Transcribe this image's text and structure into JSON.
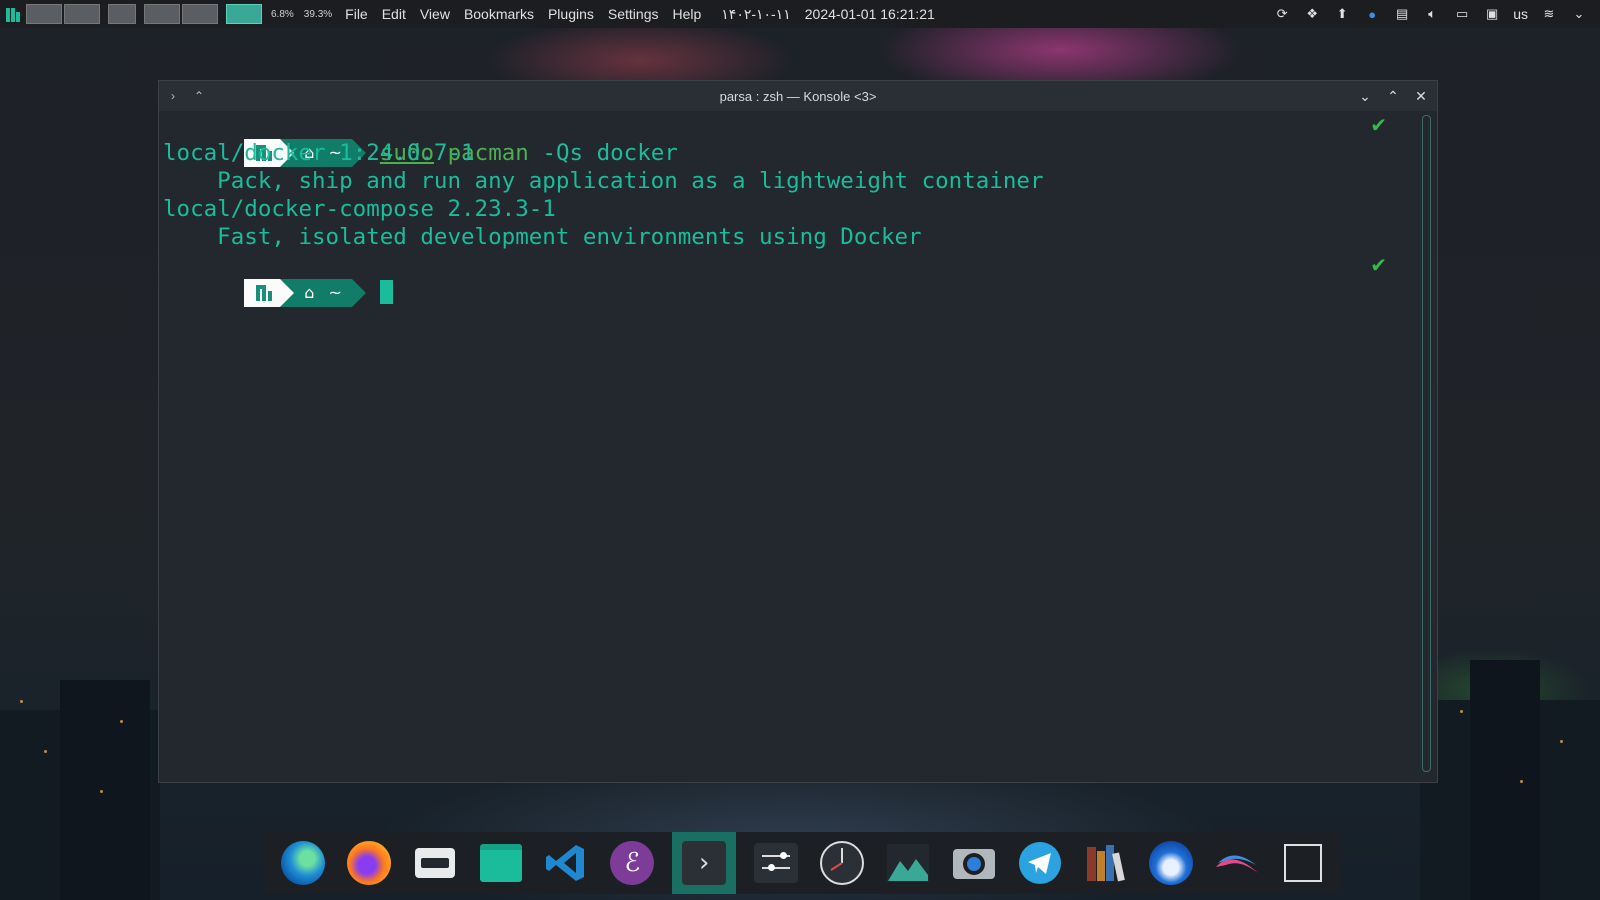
{
  "panel": {
    "sysmon": {
      "cpu": "6.8%",
      "mem": "39.3%"
    },
    "menu": [
      "File",
      "Edit",
      "View",
      "Bookmarks",
      "Plugins",
      "Settings",
      "Help"
    ],
    "clock": {
      "persian_date": "۱۴۰۲-۱۰-۱۱",
      "datetime": "2024-01-01 16:21:21"
    },
    "tray": {
      "icons": [
        "steam-icon",
        "network-share-icon",
        "update-icon",
        "sync-icon",
        "clipboard-icon",
        "volume-icon",
        "battery-icon",
        "display-icon"
      ],
      "keyboard_layout": "us"
    }
  },
  "window": {
    "title": "parsa : zsh — Konsole <3>"
  },
  "terminal": {
    "prompt_dir": "~",
    "command": {
      "sudo": "sudo",
      "pacman": "pacman",
      "args": " -Qs docker"
    },
    "output": [
      "local/docker 1:24.0.7-1",
      "    Pack, ship and run any application as a lightweight container",
      "local/docker-compose 2.23.3-1",
      "    Fast, isolated development environments using Docker"
    ],
    "status_mark": "✔"
  },
  "dock": {
    "apps": [
      {
        "name": "edge-icon",
        "color": "#1f8fd6"
      },
      {
        "name": "firefox-icon",
        "color": "#ff7a1a"
      },
      {
        "name": "pamac-icon",
        "color": "#3aa896"
      },
      {
        "name": "files-icon",
        "color": "#1abc9c"
      },
      {
        "name": "vscode-icon",
        "color": "#1f88d1"
      },
      {
        "name": "emacs-icon",
        "color": "#8e44ad"
      },
      {
        "name": "konsole-icon",
        "color": "#2b2f36"
      },
      {
        "name": "settings-icon",
        "color": "#2b2f36"
      },
      {
        "name": "clock-icon",
        "color": "#2b2f36"
      },
      {
        "name": "image-viewer-icon",
        "color": "#3aa896"
      },
      {
        "name": "screenshot-icon",
        "color": "#b0b7bd"
      },
      {
        "name": "telegram-icon",
        "color": "#2aa3e0"
      },
      {
        "name": "calibre-icon",
        "color": "#c17f2a"
      },
      {
        "name": "thunderbird-icon",
        "color": "#1f6fd6"
      },
      {
        "name": "kali-icon",
        "color": "#e04a8a"
      },
      {
        "name": "window-icon",
        "color": "#e0e0e0"
      }
    ]
  }
}
